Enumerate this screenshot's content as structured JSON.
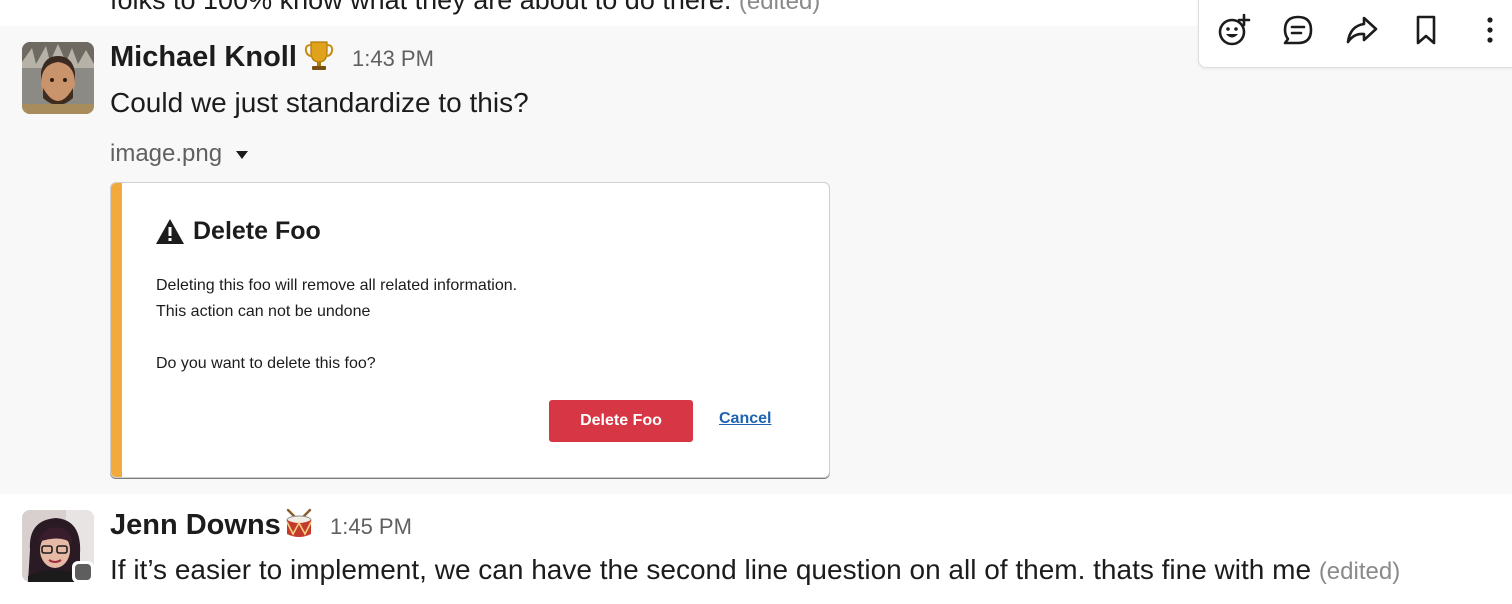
{
  "previous_message": {
    "text": "folks to 100% know what they are about to do there.",
    "edited": "(edited)"
  },
  "message_1": {
    "sender": "Michael Knoll",
    "status_emoji": "trophy-emoji",
    "timestamp": "1:43 PM",
    "text": "Could we just standardize to this?",
    "file_name": "image.png"
  },
  "dialog_preview": {
    "title": "Delete Foo",
    "line1": "Deleting this foo will remove all related information.",
    "line2": "This action can not be undone",
    "line3": "Do you want to delete this foo?",
    "delete_label": "Delete Foo",
    "cancel_label": "Cancel",
    "accent_color": "#f2aa3c",
    "delete_color": "#d73744"
  },
  "message_2": {
    "sender": "Jenn Downs",
    "status_emoji": "drum-emoji",
    "timestamp": "1:45 PM",
    "text": "If it’s easier to implement, we can have the second line question on all of them. thats fine with me",
    "edited": "(edited)"
  },
  "toolbar": {
    "icons": [
      "add-reaction-icon",
      "reply-in-thread-icon",
      "share-icon",
      "bookmark-icon",
      "more-actions-icon"
    ]
  }
}
